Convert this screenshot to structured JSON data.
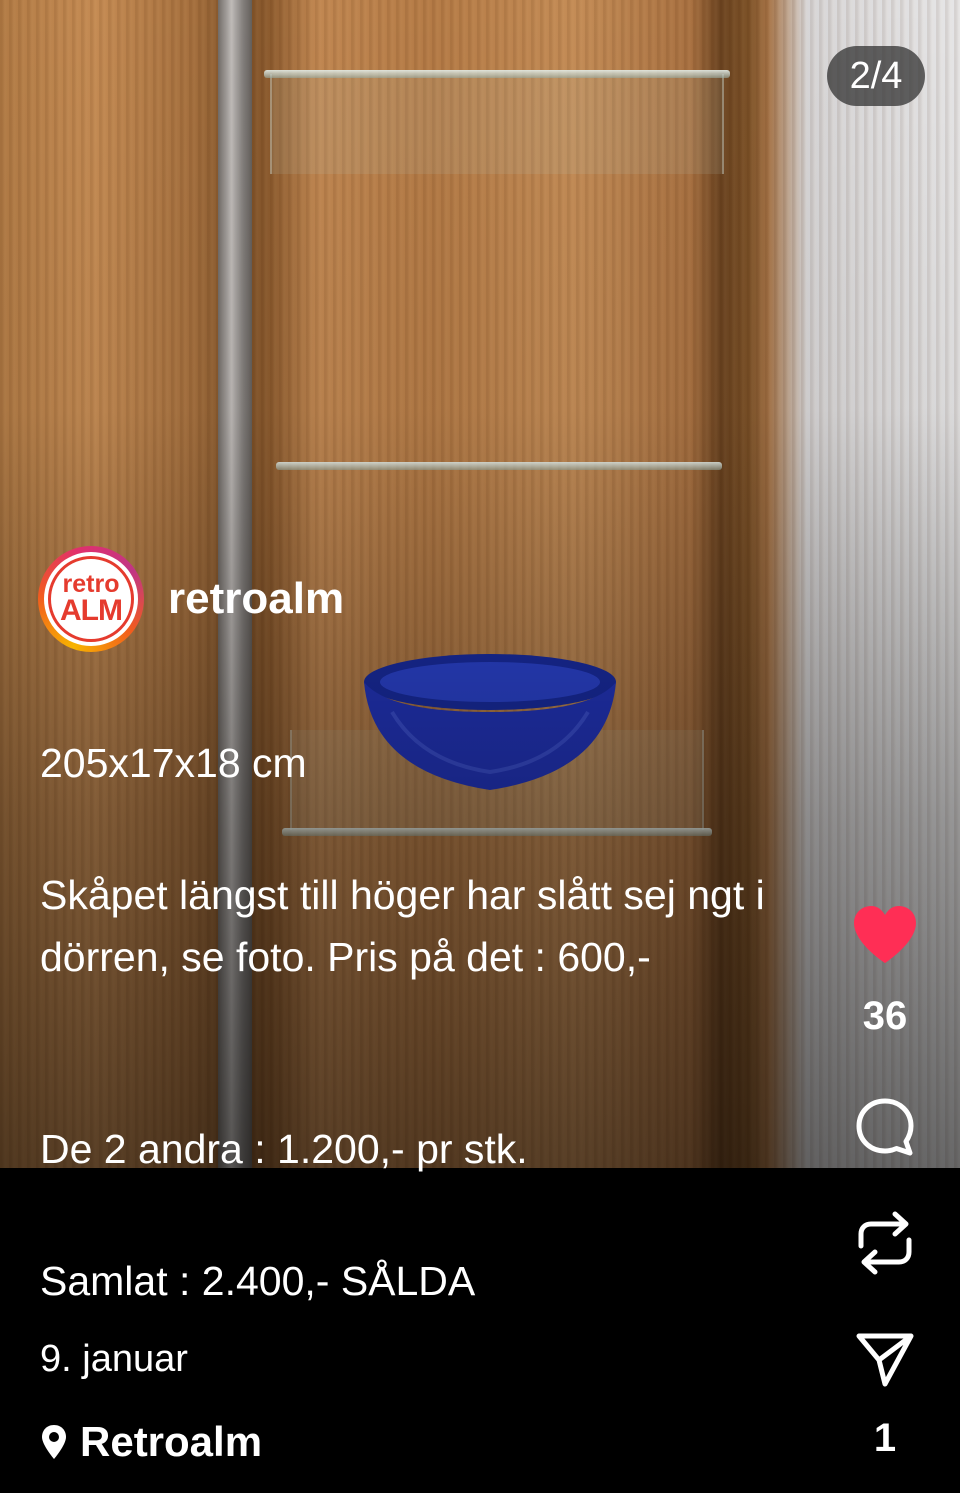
{
  "media": {
    "counter": "2/4"
  },
  "author": {
    "avatar_text_top": "retro",
    "avatar_text_bottom": "ALM",
    "username": "retroalm"
  },
  "caption": {
    "line_dimensions": "205x17x18 cm",
    "paragraph_1": "Skåpet längst till höger har slått sej ngt i dörren, se foto. Pris på det : 600,-",
    "paragraph_2": "De 2 andra : 1.200,- pr stk.",
    "paragraph_3": "Samlat : 2.400,- SÅLDA",
    "date": "9. januar"
  },
  "location": {
    "name": "Retroalm",
    "icon": "location-pin-icon"
  },
  "actions": {
    "like_icon": "heart-icon",
    "like_count": "36",
    "comment_icon": "comment-icon",
    "repost_icon": "repost-icon",
    "share_icon": "send-icon",
    "share_count": "1"
  },
  "colors": {
    "like": "#ff2e55",
    "avatar_red": "#e53b2e",
    "counter_bg": "#323232"
  }
}
